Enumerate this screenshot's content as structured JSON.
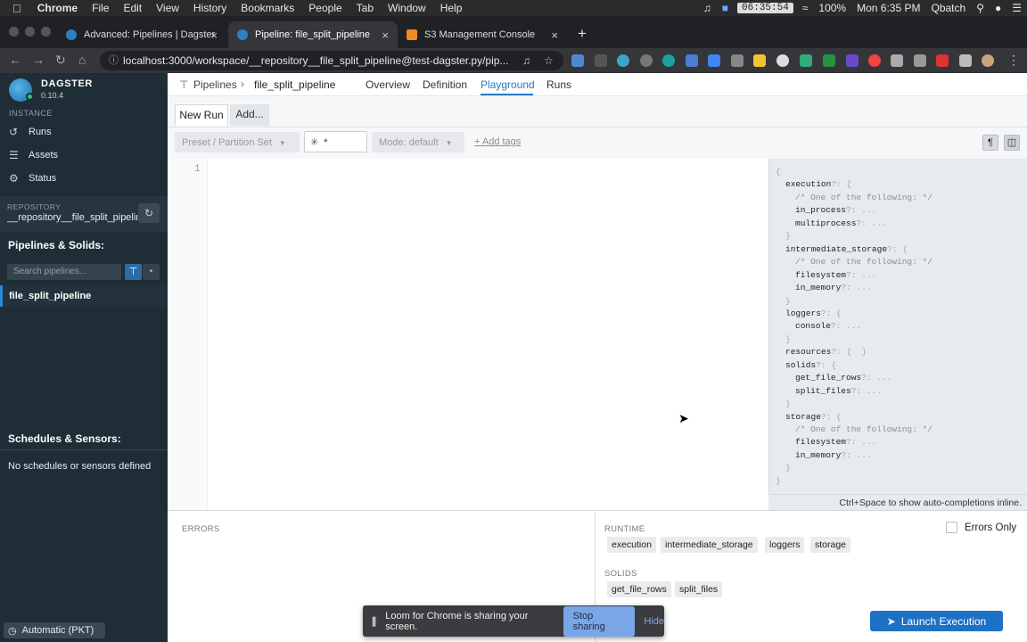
{
  "menubar": {
    "apple": "",
    "app": "Chrome",
    "items": [
      "File",
      "Edit",
      "View",
      "History",
      "Bookmarks",
      "People",
      "Tab",
      "Window",
      "Help"
    ],
    "clock": "06:35:54",
    "battery": "100%",
    "datetime": "Mon 6:35 PM",
    "user": "Qbatch"
  },
  "tabs": [
    {
      "title": "Advanced: Pipelines | Dagster",
      "favicon_color": "#2c7fc0"
    },
    {
      "title": "Pipeline: file_split_pipeline",
      "favicon_color": "#2c7fc0"
    },
    {
      "title": "S3 Management Console",
      "favicon_color": "#f08a24"
    }
  ],
  "address": {
    "url": "localhost:3000/workspace/__repository__file_split_pipeline@test-dagster.py/pip..."
  },
  "sidebar": {
    "brand": "DAGSTER",
    "version": "0.10.4",
    "instance_label": "INSTANCE",
    "nav": [
      {
        "label": "Runs",
        "icon": "history-icon"
      },
      {
        "label": "Assets",
        "icon": "table-icon"
      },
      {
        "label": "Status",
        "icon": "gear-icon"
      }
    ],
    "repository_label": "REPOSITORY",
    "repository_name": "__repository__file_split_pipeline",
    "pipelines_heading": "Pipelines & Solids:",
    "search_placeholder": "Search pipelines...",
    "pipeline_item": "file_split_pipeline",
    "schedules_heading": "Schedules & Sensors:",
    "schedules_empty": "No schedules or sensors defined",
    "timezone": "Automatic (PKT)"
  },
  "header": {
    "breadcrumb_root": "Pipelines",
    "breadcrumb_current": "file_split_pipeline",
    "tabs": [
      "Overview",
      "Definition",
      "Playground",
      "Runs"
    ],
    "active_tab": "Playground"
  },
  "run_tabs": {
    "new_run": "New Run",
    "add": "Add..."
  },
  "controls": {
    "preset": "Preset / Partition Set",
    "solid_selection": "*",
    "mode": "Mode: default",
    "add_tags": "+ Add tags"
  },
  "editor": {
    "line_number": "1"
  },
  "schema_lines": [
    {
      "indent": 0,
      "key": "",
      "suffix": "{"
    },
    {
      "indent": 1,
      "key": "execution",
      "suffix": "?: {"
    },
    {
      "indent": 2,
      "key": "/* One of the following: */",
      "suffix": "",
      "comment": true
    },
    {
      "indent": 2,
      "key": "in_process",
      "suffix": "?: ..."
    },
    {
      "indent": 2,
      "key": "multiprocess",
      "suffix": "?: ..."
    },
    {
      "indent": 1,
      "key": "",
      "suffix": "}"
    },
    {
      "indent": 1,
      "key": "intermediate_storage",
      "suffix": "?: {"
    },
    {
      "indent": 2,
      "key": "/* One of the following: */",
      "suffix": "",
      "comment": true
    },
    {
      "indent": 2,
      "key": "filesystem",
      "suffix": "?: ..."
    },
    {
      "indent": 2,
      "key": "in_memory",
      "suffix": "?: ..."
    },
    {
      "indent": 1,
      "key": "",
      "suffix": "}"
    },
    {
      "indent": 1,
      "key": "loggers",
      "suffix": "?: {"
    },
    {
      "indent": 2,
      "key": "console",
      "suffix": "?: ..."
    },
    {
      "indent": 1,
      "key": "",
      "suffix": "}"
    },
    {
      "indent": 1,
      "key": "resources",
      "suffix": "?: {  }"
    },
    {
      "indent": 1,
      "key": "solids",
      "suffix": "?: {"
    },
    {
      "indent": 2,
      "key": "get_file_rows",
      "suffix": "?: ..."
    },
    {
      "indent": 2,
      "key": "split_files",
      "suffix": "?: ..."
    },
    {
      "indent": 1,
      "key": "",
      "suffix": "}"
    },
    {
      "indent": 1,
      "key": "storage",
      "suffix": "?: {"
    },
    {
      "indent": 2,
      "key": "/* One of the following: */",
      "suffix": "",
      "comment": true
    },
    {
      "indent": 2,
      "key": "filesystem",
      "suffix": "?: ..."
    },
    {
      "indent": 2,
      "key": "in_memory",
      "suffix": "?: ..."
    },
    {
      "indent": 1,
      "key": "",
      "suffix": "}"
    },
    {
      "indent": 0,
      "key": "",
      "suffix": "}"
    }
  ],
  "schema_hint": "Ctrl+Space to show auto-completions inline.",
  "bottom": {
    "errors_label": "ERRORS",
    "runtime_label": "RUNTIME",
    "errors_only": "Errors Only",
    "runtime_chips": [
      "execution",
      "intermediate_storage",
      "loggers",
      "storage"
    ],
    "solids_label": "SOLIDS",
    "solid_chips": [
      "get_file_rows",
      "split_files"
    ],
    "launch": "Launch Execution"
  },
  "toast": {
    "message": "Loom for Chrome is sharing your screen.",
    "stop": "Stop sharing",
    "hide": "Hide"
  }
}
